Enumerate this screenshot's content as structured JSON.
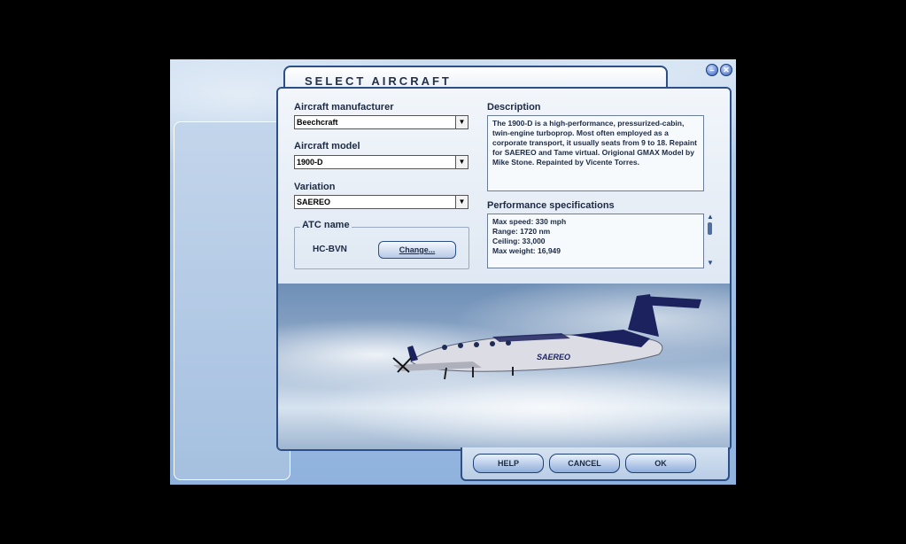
{
  "window": {
    "title": "SELECT AIRCRAFT",
    "minimize_glyph": "–",
    "close_glyph": "✕"
  },
  "form": {
    "manufacturer_label": "Aircraft manufacturer",
    "manufacturer_value": "Beechcraft",
    "model_label": "Aircraft model",
    "model_value": "1900-D",
    "variation_label": "Variation",
    "variation_value": "SAEREO",
    "atc_group_label": "ATC name",
    "atc_value": "HC-BVN",
    "change_button": "Change..."
  },
  "description": {
    "label": "Description",
    "text": "The 1900-D is a high-performance, pressurized-cabin, twin-engine turboprop. Most often employed as a corporate transport, it usually seats from 9 to 18. Repaint for SAEREO and Tame virtual. Origional GMAX Model by Mike Stone. Repainted by Vicente Torres."
  },
  "performance": {
    "label": "Performance specifications",
    "lines": [
      "Max speed: 330 mph",
      "Range: 1720 nm",
      "Ceiling: 33,000",
      "Max weight: 16,949"
    ]
  },
  "aircraft_livery_text": "SAEREO",
  "buttons": {
    "help": "HELP",
    "cancel": "CANCEL",
    "ok": "OK"
  },
  "icons": {
    "dropdown": "chevron-down-icon",
    "scroll_up": "scroll-up-icon",
    "scroll_down": "scroll-down-icon"
  }
}
